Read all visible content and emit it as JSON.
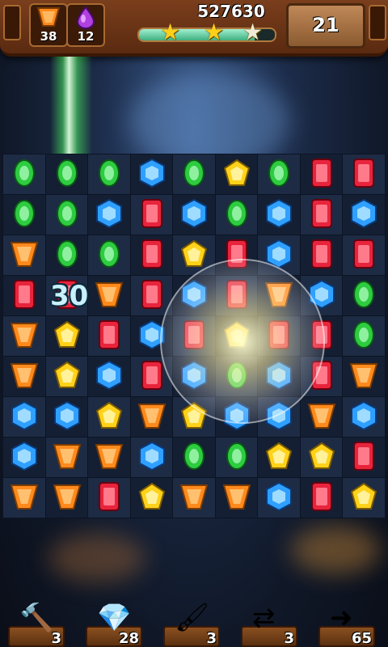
{
  "top": {
    "score": "527630",
    "moves_left": "21",
    "progress": 0.85,
    "stars": [
      {
        "earned": true
      },
      {
        "earned": true
      },
      {
        "earned": false
      }
    ],
    "goals": [
      {
        "gem": "orange-trapezoid",
        "count": "38"
      },
      {
        "gem": "purple-drop",
        "count": "12"
      }
    ]
  },
  "board": {
    "rows": [
      [
        "green",
        "green",
        "green",
        "blue",
        "green",
        "yellow",
        "green",
        "red",
        "red"
      ],
      [
        "green",
        "green",
        "blue",
        "red",
        "blue",
        "green",
        "blue",
        "red",
        "blue"
      ],
      [
        "orange",
        "green",
        "green",
        "red",
        "yellow",
        "red",
        "blue",
        "red",
        "red"
      ],
      [
        "red",
        "red",
        "orange",
        "red",
        "blue",
        "red",
        "orange",
        "blue",
        "green"
      ],
      [
        "orange",
        "yellow",
        "red",
        "blue",
        "red",
        "yellow",
        "red",
        "red",
        "green"
      ],
      [
        "orange",
        "yellow",
        "blue",
        "red",
        "blue",
        "green",
        "blue",
        "red",
        "orange"
      ],
      [
        "blue",
        "blue",
        "yellow",
        "orange",
        "yellow",
        "blue",
        "blue",
        "orange",
        "blue"
      ],
      [
        "blue",
        "orange",
        "orange",
        "blue",
        "green",
        "green",
        "yellow",
        "yellow",
        "red"
      ],
      [
        "orange",
        "orange",
        "red",
        "yellow",
        "orange",
        "orange",
        "blue",
        "red",
        "yellow"
      ]
    ],
    "combo_text": "30"
  },
  "tools": [
    {
      "name": "hammer",
      "icon": "hammer-icon",
      "count": "3"
    },
    {
      "name": "rainbow-gem",
      "icon": "rainbow-gem-icon",
      "count": "28"
    },
    {
      "name": "paintbrush",
      "icon": "paintbrush-icon",
      "count": "3"
    },
    {
      "name": "swap",
      "icon": "swap-arrows-icon",
      "count": "3"
    },
    {
      "name": "extra-moves",
      "icon": "plus-five-moves-icon",
      "count": "65"
    }
  ],
  "colors": {
    "green": "#2ecc40",
    "blue": "#2fa0ff",
    "red": "#e8243c",
    "yellow": "#ffd21a",
    "orange": "#ff8a1c",
    "wood": "#7a3e1c"
  }
}
